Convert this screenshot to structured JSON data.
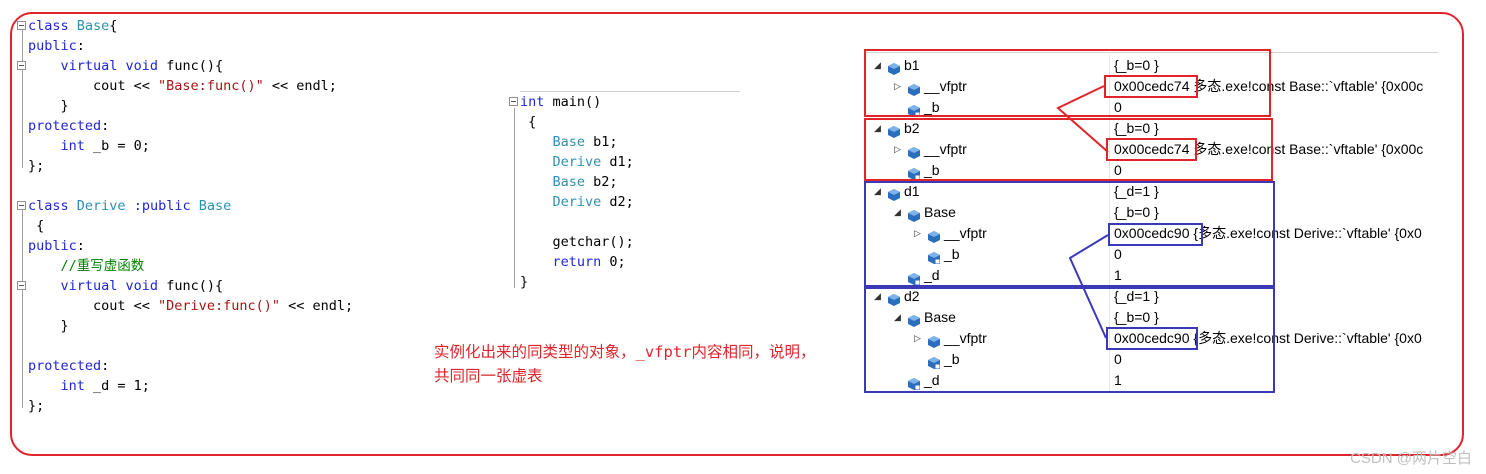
{
  "code_left": [
    [
      {
        "t": "class ",
        "c": "kw"
      },
      {
        "t": "Base",
        "c": "ty"
      },
      {
        "t": "{",
        "c": ""
      }
    ],
    [
      {
        "t": "public",
        "c": "kw"
      },
      {
        "t": ":",
        "c": ""
      }
    ],
    [
      {
        "t": "    virtual ",
        "c": "kw"
      },
      {
        "t": "void ",
        "c": "kw"
      },
      {
        "t": "func(){",
        "c": ""
      }
    ],
    [
      {
        "t": "        cout << ",
        "c": ""
      },
      {
        "t": "\"Base:func()\"",
        "c": "st"
      },
      {
        "t": " << endl;",
        "c": ""
      }
    ],
    [
      {
        "t": "    }",
        "c": ""
      }
    ],
    [
      {
        "t": "protected",
        "c": "kw"
      },
      {
        "t": ":",
        "c": ""
      }
    ],
    [
      {
        "t": "    int ",
        "c": "kw"
      },
      {
        "t": "_b = 0;",
        "c": ""
      }
    ],
    [
      {
        "t": "};",
        "c": ""
      }
    ],
    [
      {
        "t": "",
        "c": ""
      }
    ],
    [
      {
        "t": "class ",
        "c": "kw"
      },
      {
        "t": "Derive ",
        "c": "ty"
      },
      {
        "t": ":public ",
        "c": "kw"
      },
      {
        "t": "Base",
        "c": "ty"
      }
    ],
    [
      {
        "t": " {",
        "c": ""
      }
    ],
    [
      {
        "t": "public",
        "c": "kw"
      },
      {
        "t": ":",
        "c": ""
      }
    ],
    [
      {
        "t": "    //重写虚函数",
        "c": "cm"
      }
    ],
    [
      {
        "t": "    virtual ",
        "c": "kw"
      },
      {
        "t": "void ",
        "c": "kw"
      },
      {
        "t": "func(){",
        "c": ""
      }
    ],
    [
      {
        "t": "        cout << ",
        "c": ""
      },
      {
        "t": "\"Derive:func()\"",
        "c": "st"
      },
      {
        "t": " << endl;",
        "c": ""
      }
    ],
    [
      {
        "t": "    }",
        "c": ""
      }
    ],
    [
      {
        "t": "",
        "c": ""
      }
    ],
    [
      {
        "t": "protected",
        "c": "kw"
      },
      {
        "t": ":",
        "c": ""
      }
    ],
    [
      {
        "t": "    int ",
        "c": "kw"
      },
      {
        "t": "_d = 1;",
        "c": ""
      }
    ],
    [
      {
        "t": "};",
        "c": ""
      }
    ]
  ],
  "code_main": [
    [
      {
        "t": "int ",
        "c": "kw"
      },
      {
        "t": "main()",
        "c": ""
      }
    ],
    [
      {
        "t": " {",
        "c": ""
      }
    ],
    [
      {
        "t": "    Base ",
        "c": "ty"
      },
      {
        "t": "b1;",
        "c": ""
      }
    ],
    [
      {
        "t": "    Derive ",
        "c": "ty"
      },
      {
        "t": "d1;",
        "c": ""
      }
    ],
    [
      {
        "t": "    Base ",
        "c": "ty"
      },
      {
        "t": "b2;",
        "c": ""
      }
    ],
    [
      {
        "t": "    Derive ",
        "c": "ty"
      },
      {
        "t": "d2;",
        "c": ""
      }
    ],
    [
      {
        "t": "",
        "c": ""
      }
    ],
    [
      {
        "t": "    getchar();",
        "c": ""
      }
    ],
    [
      {
        "t": "    return ",
        "c": "kw"
      },
      {
        "t": "0;",
        "c": ""
      }
    ],
    [
      {
        "t": "}",
        "c": ""
      }
    ]
  ],
  "annotation": "实例化出来的同类型的对象，_vfptr内容相同，说明，共同同一张虚表",
  "watch_rows": [
    {
      "indent": 0,
      "arrow": "expanded",
      "icon": "object",
      "name": "b1",
      "value": "{_b=0 }"
    },
    {
      "indent": 1,
      "arrow": "collapsed",
      "icon": "object",
      "name": "__vfptr",
      "value": "0x00cedc74 多态.exe!const Base::`vftable' {0x00c"
    },
    {
      "indent": 1,
      "arrow": "none",
      "icon": "field",
      "name": "_b",
      "value": "0"
    },
    {
      "indent": 0,
      "arrow": "expanded",
      "icon": "object",
      "name": "b2",
      "value": "{_b=0 }"
    },
    {
      "indent": 1,
      "arrow": "collapsed",
      "icon": "object",
      "name": "__vfptr",
      "value": "0x00cedc74 多态.exe!const Base::`vftable' {0x00c"
    },
    {
      "indent": 1,
      "arrow": "none",
      "icon": "field",
      "name": "_b",
      "value": "0"
    },
    {
      "indent": 0,
      "arrow": "expanded",
      "icon": "object",
      "name": "d1",
      "value": "{_d=1 }"
    },
    {
      "indent": 1,
      "arrow": "expanded",
      "icon": "object",
      "name": "Base",
      "value": "{_b=0 }"
    },
    {
      "indent": 2,
      "arrow": "collapsed",
      "icon": "object",
      "name": "__vfptr",
      "value": "0x00cedc90 {多态.exe!const Derive::`vftable' {0x0"
    },
    {
      "indent": 2,
      "arrow": "none",
      "icon": "field",
      "name": "_b",
      "value": "0"
    },
    {
      "indent": 1,
      "arrow": "none",
      "icon": "field",
      "name": "_d",
      "value": "1"
    },
    {
      "indent": 0,
      "arrow": "expanded",
      "icon": "object",
      "name": "d2",
      "value": "{_d=1 }"
    },
    {
      "indent": 1,
      "arrow": "expanded",
      "icon": "object",
      "name": "Base",
      "value": "{_b=0 }"
    },
    {
      "indent": 2,
      "arrow": "collapsed",
      "icon": "object",
      "name": "__vfptr",
      "value": "0x00cedc90 {多态.exe!const Derive::`vftable' {0x0"
    },
    {
      "indent": 2,
      "arrow": "none",
      "icon": "field",
      "name": "_b",
      "value": "0"
    },
    {
      "indent": 1,
      "arrow": "none",
      "icon": "field",
      "name": "_d",
      "value": "1"
    }
  ],
  "colors": {
    "highlight_red": "#e0242a",
    "highlight_blue": "#3a3ab8",
    "icon_blue": "#2a6ebd"
  },
  "watermark": "CSDN @两片空白"
}
